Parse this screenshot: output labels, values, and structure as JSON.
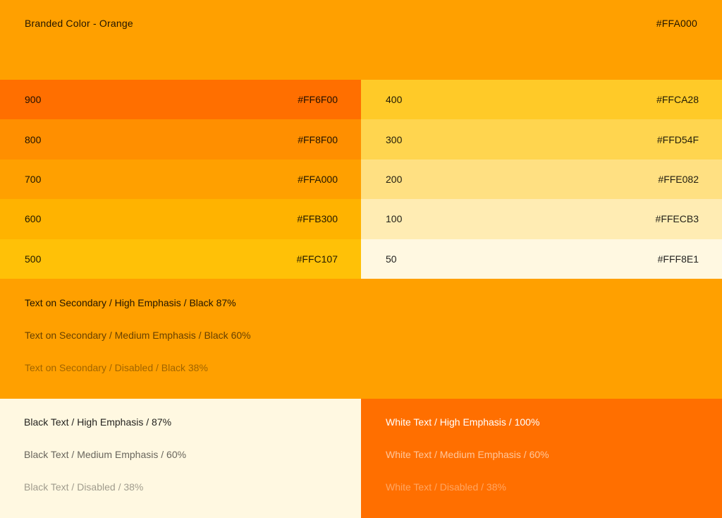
{
  "header": {
    "title": "Branded Color - Orange",
    "hex": "#FFA000",
    "background": "#FFA000"
  },
  "swatches_left": [
    {
      "shade": "900",
      "hex": "#FF6F00"
    },
    {
      "shade": "800",
      "hex": "#FF8F00"
    },
    {
      "shade": "700",
      "hex": "#FFA000"
    },
    {
      "shade": "600",
      "hex": "#FFB300"
    },
    {
      "shade": "500",
      "hex": "#FFC107"
    }
  ],
  "swatches_right": [
    {
      "shade": "400",
      "hex": "#FFCA28"
    },
    {
      "shade": "300",
      "hex": "#FFD54F"
    },
    {
      "shade": "200",
      "hex": "#FFE082"
    },
    {
      "shade": "100",
      "hex": "#FFECB3"
    },
    {
      "shade": "50",
      "hex": "#FFF8E1"
    }
  ],
  "text_on_secondary": {
    "background": "#FFA000",
    "high": "Text on Secondary / High Emphasis / Black 87%",
    "medium": "Text on Secondary / Medium Emphasis / Black 60%",
    "disabled": "Text on Secondary / Disabled / Black 38%"
  },
  "black_text_panel": {
    "background": "#FFF8E1",
    "high": "Black Text / High Emphasis / 87%",
    "medium": "Black Text / Medium Emphasis / 60%",
    "disabled": "Black Text / Disabled / 38%"
  },
  "white_text_panel": {
    "background": "#FF6F00",
    "high": "White Text / High Emphasis / 100%",
    "medium": "White Text / Medium Emphasis / 60%",
    "disabled": "White Text / Disabled / 38%"
  }
}
